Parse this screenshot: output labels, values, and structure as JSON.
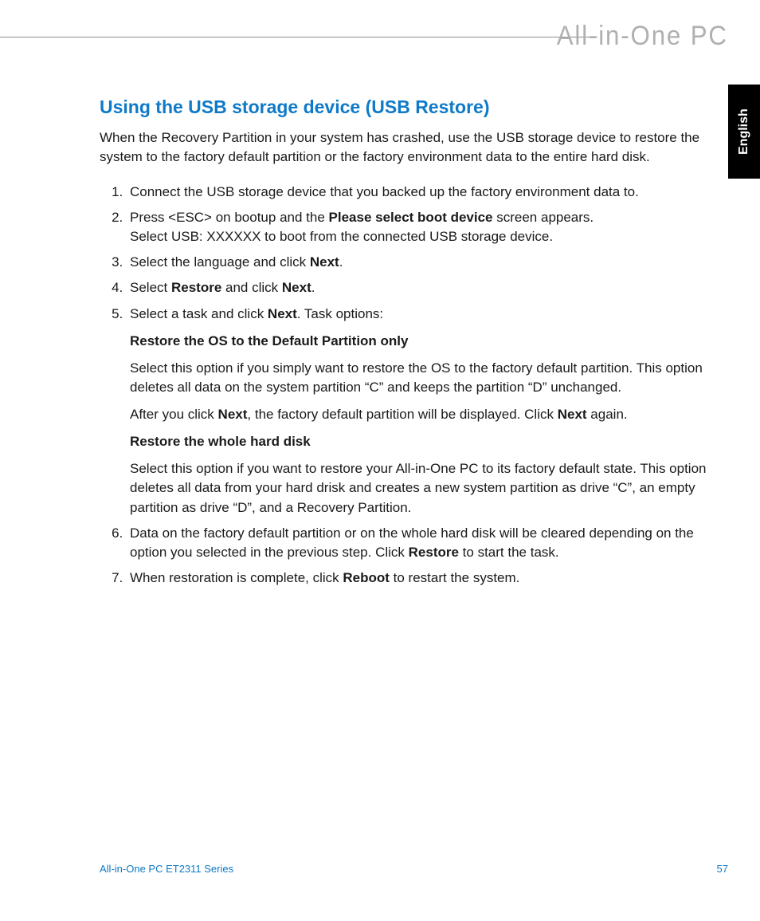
{
  "header": {
    "brand": "All-in-One PC",
    "language_tab": "English"
  },
  "content": {
    "title": "Using the USB storage device (USB Restore)",
    "intro": "When the Recovery Partition in your system has crashed, use the USB storage device to restore the system to the factory default partition or the factory environment data to the entire hard disk.",
    "step1": "Connect the USB storage device that you backed up the factory environment data to.",
    "step2_a": "Press <ESC> on bootup and the ",
    "step2_bold": "Please select boot device",
    "step2_b": " screen appears.",
    "step2_line2": "Select USB: XXXXXX to boot from the connected USB storage device.",
    "step3_a": "Select the language and click ",
    "step3_bold": "Next",
    "step3_b": ".",
    "step4_a": "Select ",
    "step4_bold1": "Restore",
    "step4_mid": " and click ",
    "step4_bold2": "Next",
    "step4_b": ".",
    "step5_a": "Select a task and click ",
    "step5_bold": "Next",
    "step5_b": ". Task options:",
    "step5_sub1_title": "Restore the OS to the Default Partition only",
    "step5_sub1_p1": "Select this option if you simply want to restore the OS to the factory default partition. This option deletes all data on the system partition “C” and keeps the partition “D” unchanged.",
    "step5_sub1_p2_a": "After you click ",
    "step5_sub1_p2_bold1": "Next",
    "step5_sub1_p2_mid": ", the factory default partition will be displayed. Click ",
    "step5_sub1_p2_bold2": "Next",
    "step5_sub1_p2_b": " again.",
    "step5_sub2_title": "Restore the whole hard disk",
    "step5_sub2_p1": "Select this option if you want to restore your All-in-One PC to its factory default state. This option deletes all data from your hard drisk and creates a new system partition as drive “C”, an empty partition as drive “D”, and a Recovery Partition.",
    "step6_a": "Data on the factory default partition or on the whole hard disk will be cleared depending on the option you selected in the previous step. Click ",
    "step6_bold": "Restore",
    "step6_b": " to start the task.",
    "step7_a": "When restoration is complete, click ",
    "step7_bold": "Reboot",
    "step7_b": " to restart the system."
  },
  "footer": {
    "left": "All-in-One PC ET2311 Series",
    "right": "57"
  }
}
